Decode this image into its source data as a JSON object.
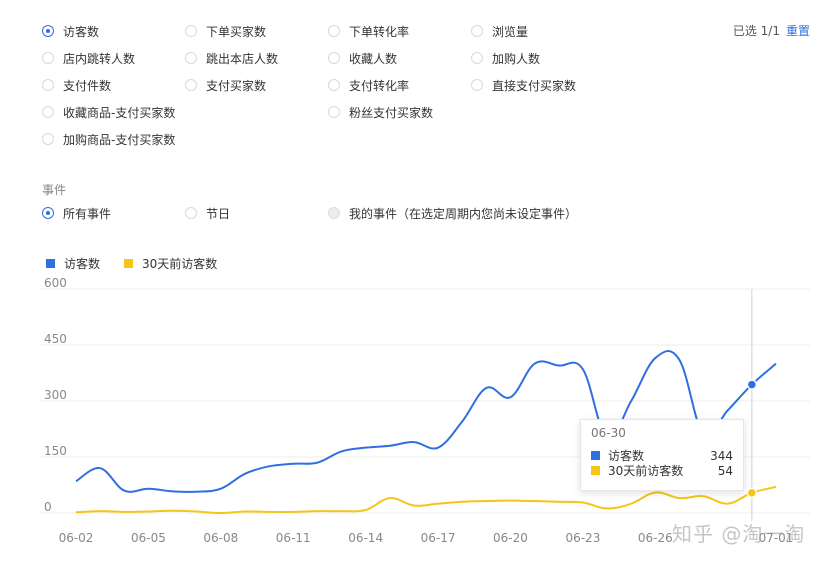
{
  "metrics": {
    "selected_text": "已选 1/1",
    "reset_label": "重置",
    "options": [
      {
        "label": "访客数",
        "checked": true
      },
      {
        "label": "下单买家数",
        "checked": false
      },
      {
        "label": "下单转化率",
        "checked": false
      },
      {
        "label": "浏览量",
        "checked": false
      },
      {
        "label": "店内跳转人数",
        "checked": false
      },
      {
        "label": "跳出本店人数",
        "checked": false
      },
      {
        "label": "收藏人数",
        "checked": false
      },
      {
        "label": "加购人数",
        "checked": false
      },
      {
        "label": "支付件数",
        "checked": false
      },
      {
        "label": "支付买家数",
        "checked": false
      },
      {
        "label": "支付转化率",
        "checked": false
      },
      {
        "label": "直接支付买家数",
        "checked": false
      },
      {
        "label": "收藏商品-支付买家数",
        "checked": false
      },
      {
        "label": "粉丝支付买家数",
        "checked": false
      },
      {
        "label": "加购商品-支付买家数",
        "checked": false
      }
    ]
  },
  "events": {
    "title": "事件",
    "options": [
      {
        "label": "所有事件",
        "checked": true,
        "disabled": false
      },
      {
        "label": "节日",
        "checked": false,
        "disabled": false
      },
      {
        "label": "我的事件（在选定周期内您尚未设定事件）",
        "checked": false,
        "disabled": true
      }
    ]
  },
  "colors": {
    "accent": "#2f6fe0",
    "series_current": "#2f6fe0",
    "series_previous": "#f5c518",
    "grid": "#eeeeee"
  },
  "chart_data": {
    "type": "line",
    "title": "",
    "xlabel": "",
    "ylabel": "",
    "ylim": [
      0,
      600
    ],
    "yticks": [
      0,
      150,
      300,
      450,
      600
    ],
    "grid": true,
    "legend_position": "top-left",
    "x": [
      "06-02",
      "06-03",
      "06-04",
      "06-05",
      "06-06",
      "06-07",
      "06-08",
      "06-09",
      "06-10",
      "06-11",
      "06-12",
      "06-13",
      "06-14",
      "06-15",
      "06-16",
      "06-17",
      "06-18",
      "06-19",
      "06-20",
      "06-21",
      "06-22",
      "06-23",
      "06-24",
      "06-25",
      "06-26",
      "06-27",
      "06-28",
      "06-29",
      "06-30",
      "07-01"
    ],
    "x_tick_labels": [
      "06-02",
      "06-05",
      "06-08",
      "06-11",
      "06-14",
      "06-17",
      "06-20",
      "06-23",
      "06-26",
      "07-01"
    ],
    "series": [
      {
        "name": "访客数",
        "color": "#2f6fe0",
        "values": [
          85,
          120,
          60,
          65,
          58,
          57,
          65,
          105,
          125,
          132,
          135,
          165,
          175,
          180,
          190,
          175,
          245,
          335,
          310,
          400,
          395,
          385,
          200,
          300,
          415,
          410,
          210,
          275,
          344,
          400
        ]
      },
      {
        "name": "30天前访客数",
        "color": "#f5c518",
        "values": [
          2,
          5,
          3,
          4,
          6,
          4,
          0,
          4,
          3,
          3,
          5,
          5,
          8,
          40,
          20,
          25,
          30,
          32,
          33,
          32,
          30,
          28,
          12,
          25,
          55,
          40,
          45,
          25,
          54,
          70
        ]
      }
    ]
  },
  "tooltip": {
    "date": "06-30",
    "rows": [
      {
        "label": "访客数",
        "value": "344",
        "color": "#2f6fe0"
      },
      {
        "label": "30天前访客数",
        "value": "54",
        "color": "#f5c518"
      }
    ]
  },
  "watermark": "知乎 @淘一淘"
}
